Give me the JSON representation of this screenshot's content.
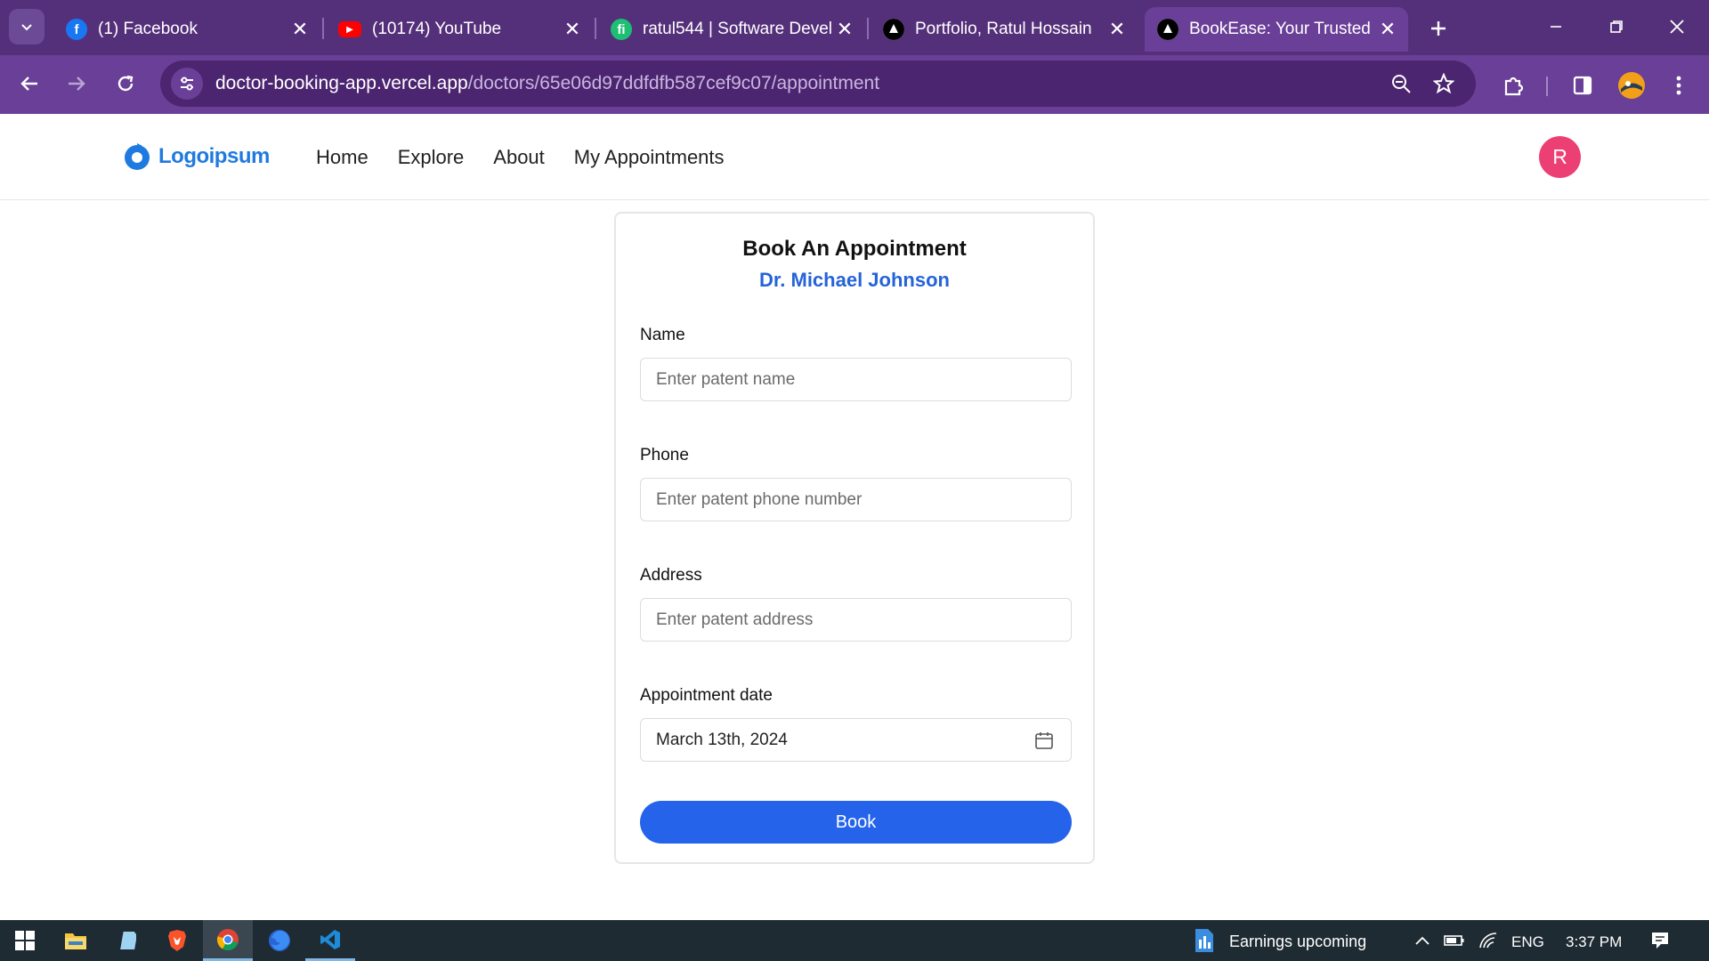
{
  "browser": {
    "tabs": [
      {
        "title": "(1) Facebook",
        "icon": "facebook-icon",
        "color": "#1877f2"
      },
      {
        "title": "(10174) YouTube",
        "icon": "youtube-icon",
        "color": "#ff0000"
      },
      {
        "title": "ratul544 | Software Devel",
        "icon": "fiverr-icon",
        "color": "#1dbf73"
      },
      {
        "title": "Portfolio, Ratul Hossain",
        "icon": "triangle-icon",
        "color": "#000000"
      },
      {
        "title": "BookEase: Your Trusted D",
        "icon": "triangle-icon",
        "color": "#000000"
      }
    ],
    "url_domain": "doctor-booking-app.vercel.app",
    "url_path": "/doctors/65e06d97ddfdfb587cef9c07/appointment"
  },
  "site": {
    "logo_text": "Logoipsum",
    "nav": [
      "Home",
      "Explore",
      "About",
      "My Appointments"
    ],
    "avatar_initial": "R",
    "accent": "#2563eb",
    "avatar_color": "#ec3f74"
  },
  "form": {
    "title": "Book An Appointment",
    "doctor": "Dr. Michael Johnson",
    "name_label": "Name",
    "name_placeholder": "Enter patent name",
    "phone_label": "Phone",
    "phone_placeholder": "Enter patent phone number",
    "address_label": "Address",
    "address_placeholder": "Enter patent address",
    "date_label": "Appointment date",
    "date_value": "March 13th, 2024",
    "submit_label": "Book"
  },
  "taskbar": {
    "news": "Earnings upcoming",
    "lang": "ENG",
    "time": "3:37 PM"
  }
}
